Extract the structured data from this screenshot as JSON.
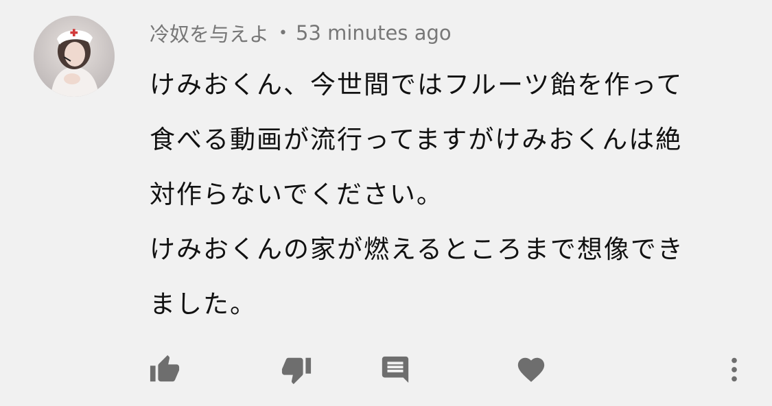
{
  "comment": {
    "author": "冷奴を与えよ",
    "separator": "•",
    "time": "53 minutes ago",
    "lines": [
      "けみおくん、今世間ではフルーツ飴を作って",
      "食べる動画が流行ってますがけみおくんは絶",
      "対作らないでください。",
      "けみおくんの家が燃えるところまで想像でき",
      "ました。"
    ]
  },
  "actions": {
    "like_icon": "thumbs-up-icon",
    "dislike_icon": "thumbs-down-icon",
    "reply_icon": "comment-icon",
    "heart_icon": "heart-icon",
    "more_icon": "more-vertical-icon"
  },
  "colors": {
    "background": "#f1f1f1",
    "text": "#111111",
    "meta": "#777777",
    "icon": "#6e6e6e"
  }
}
